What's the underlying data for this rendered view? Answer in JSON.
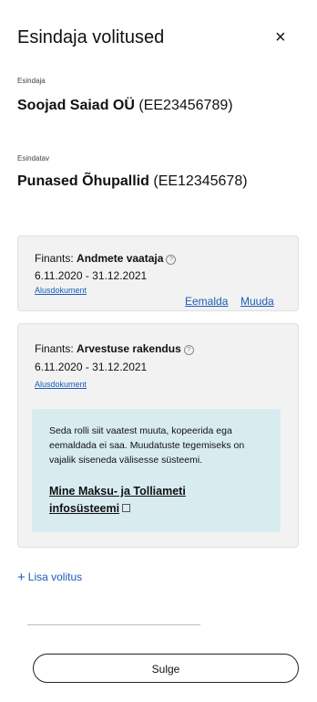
{
  "header": {
    "title": "Esindaja volitused",
    "close_symbol": "×"
  },
  "representative": {
    "label": "Esindaja",
    "name": "Soojad Saiad OÜ",
    "code": "(EE23456789)"
  },
  "represented": {
    "label": "Esindatav",
    "name": "Punased Õhupallid",
    "code": "(EE12345678)"
  },
  "authorizations": [
    {
      "domain": "Finants:",
      "role": "Andmete vaataja",
      "period": "6.11.2020 - 31.12.2021",
      "document_link": "Alusdokument",
      "remove_label": "Eemalda",
      "edit_label": "Muuda"
    },
    {
      "domain": "Finants:",
      "role": "Arvestuse rakendus",
      "period": "6.11.2020 - 31.12.2021",
      "document_link": "Alusdokument",
      "info_text": "Seda rolli siit vaatest muuta, kopeerida ega eemaldada ei saa. Muudatuste tegemiseks on vajalik siseneda välisesse süsteemi.",
      "info_link": "Mine Maksu- ja Tolliameti infosüsteemi"
    }
  ],
  "add_authorization": {
    "label": "Lisa volitus"
  },
  "footer": {
    "close_button_label": "Sulge"
  },
  "colors": {
    "link": "#1b5dba",
    "card_bg": "#f2f2f2",
    "info_bg": "#d8ecf0"
  },
  "icons": {
    "close": "close-icon",
    "help": "help-circle-icon",
    "external": "external-link-icon",
    "add": "plus-icon"
  }
}
